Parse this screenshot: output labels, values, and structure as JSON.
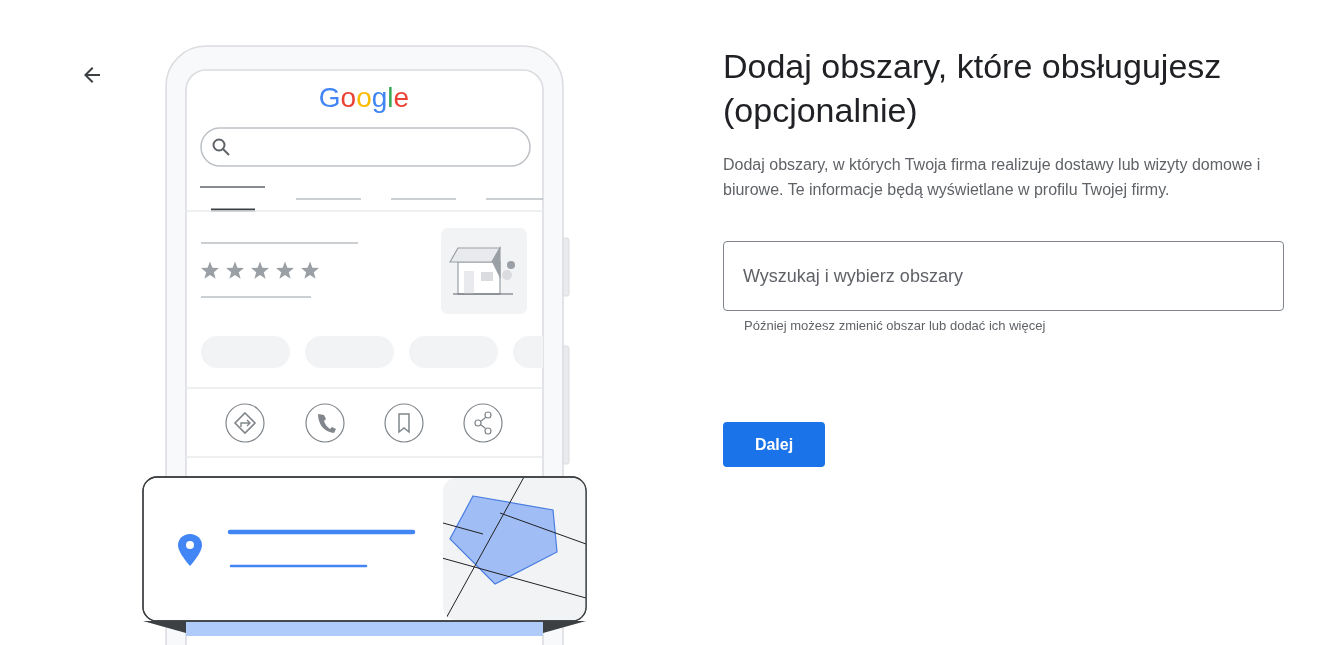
{
  "illustration": {
    "logo": "Google"
  },
  "heading": "Dodaj obszary, które obsługujesz (opcjonalnie)",
  "description": "Dodaj obszary, w których Twoja firma realizuje dostawy lub wizyty domowe i biurowe. Te informacje będą wyświetlane w profilu Twojej firmy.",
  "area_search": {
    "placeholder": "Wyszukaj i wybierz obszary",
    "helper": "Później możesz zmienić obszar lub dodać ich więcej"
  },
  "next_button": {
    "label": "Dalej"
  }
}
